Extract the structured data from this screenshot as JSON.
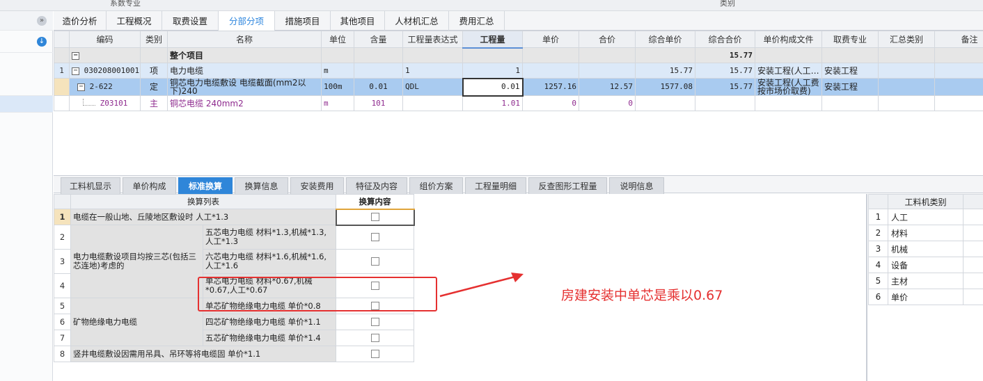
{
  "top_strip": {
    "left_text": "系数专业",
    "right_text": "类别"
  },
  "left_panel": {
    "collapse_icon": "double-chevron-up-icon",
    "download_icon": "download-icon"
  },
  "main_tabs": [
    "造价分析",
    "工程概况",
    "取费设置",
    "分部分项",
    "措施项目",
    "其他项目",
    "人材机汇总",
    "费用汇总"
  ],
  "main_active_tab": "分部分项",
  "upper_grid": {
    "headers": [
      "编码",
      "类别",
      "名称",
      "单位",
      "含量",
      "工程量表达式",
      "工程量",
      "单价",
      "合价",
      "综合单价",
      "综合合价",
      "单价构成文件",
      "取费专业",
      "汇总类别",
      "备注"
    ],
    "total_row": {
      "name": "整个项目",
      "total": "15.77"
    },
    "rows": [
      {
        "idx": "1",
        "code": "030208001001",
        "type": "项",
        "name": "电力电缆",
        "unit": "m",
        "content": "",
        "expr": "1",
        "qty": "1",
        "price": "",
        "amount": "",
        "unit_price": "15.77",
        "total_price": "15.77",
        "file": "安装工程(人工…",
        "specialty": "安装工程",
        "sum_cat": ""
      },
      {
        "idx": "",
        "code": "2-622",
        "type": "定",
        "name": "铜芯电力电缆敷设 电缆截面(mm2以下)240",
        "unit": "100m",
        "content": "0.01",
        "expr": "QDL",
        "qty": "0.01",
        "price": "1257.16",
        "amount": "12.57",
        "unit_price": "1577.08",
        "total_price": "15.77",
        "file": "安装工程(人工费按市场价取费)",
        "specialty": "安装工程",
        "sum_cat": ""
      },
      {
        "idx": "",
        "code": "Z03101",
        "type": "主",
        "name": "铜芯电缆 240mm2",
        "unit": "m",
        "content": "101",
        "expr": "",
        "qty": "1.01",
        "price": "0",
        "amount": "0",
        "unit_price": "",
        "total_price": "",
        "file": "",
        "specialty": "",
        "sum_cat": ""
      }
    ]
  },
  "bottom_tabs": [
    "工料机显示",
    "单价构成",
    "标准换算",
    "换算信息",
    "安装费用",
    "特征及内容",
    "组价方案",
    "工程量明细",
    "反查图形工程量",
    "说明信息"
  ],
  "bottom_active_tab": "标准换算",
  "conversion": {
    "header_list": "换算列表",
    "header_content": "换算内容",
    "row1": "电缆在一般山地、丘陵地区敷设时 人工*1.3",
    "group_three_core": "电力电缆敷设项目均按三芯(包括三芯连地)考虑的",
    "row2": "五芯电力电缆 材料*1.3,机械*1.3,人工*1.3",
    "row3": "六芯电力电缆 材料*1.6,机械*1.6,人工*1.6",
    "row4": "单芯电力电缆 材料*0.67,机械*0.67,人工*0.67",
    "row5": "单芯矿物绝缘电力电缆 单价*0.8",
    "group_mineral": "矿物绝缘电力电缆",
    "row6": "四芯矿物绝缘电力电缆 单价*1.1",
    "row7": "五芯矿物绝缘电力电缆 单价*1.4",
    "row8": "竖井电缆敷设因需用吊具、吊环等将电缆固 单价*1.1",
    "idx": [
      "1",
      "2",
      "3",
      "4",
      "5",
      "6",
      "7",
      "8"
    ]
  },
  "resource_types": {
    "header": "工料机类别",
    "items": [
      {
        "idx": "1",
        "label": "人工"
      },
      {
        "idx": "2",
        "label": "材料"
      },
      {
        "idx": "3",
        "label": "机械"
      },
      {
        "idx": "4",
        "label": "设备"
      },
      {
        "idx": "5",
        "label": "主材"
      },
      {
        "idx": "6",
        "label": "单价"
      }
    ]
  },
  "annotation": {
    "text": "房建安装中单芯是乘以0.67",
    "color": "#e53030"
  }
}
